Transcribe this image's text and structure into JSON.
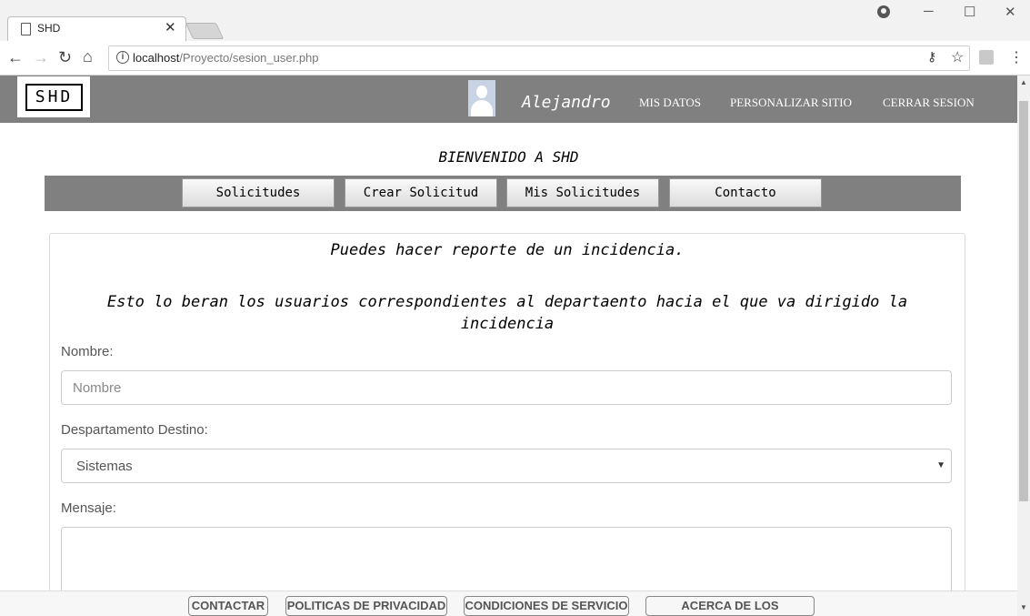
{
  "browser": {
    "tab_title": "SHD",
    "url_host": "localhost",
    "url_path": "/Proyecto/sesion_user.php"
  },
  "header": {
    "logo_text": "SHD",
    "username": "Alejandro",
    "links": [
      "MIS DATOS",
      "PERSONALIZAR SITIO",
      "CERRAR SESION"
    ]
  },
  "welcome": "BIENVENIDO A SHD",
  "menu": [
    "Solicitudes",
    "Crear Solicitud",
    "Mis Solicitudes",
    "Contacto"
  ],
  "form": {
    "intro": "Puedes hacer reporte de un incidencia.",
    "note": "Esto lo beran los usuarios correspondientes al departaento hacia el que va dirigido la incidencia",
    "name_label": "Nombre:",
    "name_placeholder": "Nombre",
    "dept_label": "Despartamento Destino:",
    "dept_value": "Sistemas",
    "message_label": "Mensaje:"
  },
  "footer": [
    "CONTACTAR",
    "POLITICAS DE PRIVACIDAD",
    "CONDICIONES DE SERVICIO",
    "ACERCA DE LOS CREADORES"
  ]
}
